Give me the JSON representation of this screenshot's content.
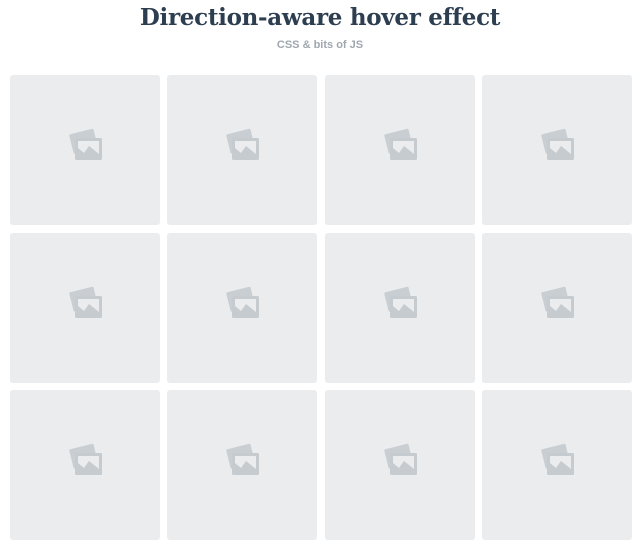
{
  "header": {
    "title": "Direction-aware hover effect",
    "subtitle": "CSS & bits of JS"
  },
  "grid": {
    "tiles": [
      {
        "icon": "image-placeholder-icon"
      },
      {
        "icon": "image-placeholder-icon"
      },
      {
        "icon": "image-placeholder-icon"
      },
      {
        "icon": "image-placeholder-icon"
      },
      {
        "icon": "image-placeholder-icon"
      },
      {
        "icon": "image-placeholder-icon"
      },
      {
        "icon": "image-placeholder-icon"
      },
      {
        "icon": "image-placeholder-icon"
      },
      {
        "icon": "image-placeholder-icon"
      },
      {
        "icon": "image-placeholder-icon"
      },
      {
        "icon": "image-placeholder-icon"
      },
      {
        "icon": "image-placeholder-icon"
      }
    ]
  },
  "colors": {
    "title": "#2c3e50",
    "subtitle": "#a0a7af",
    "tile_background": "#eaecee",
    "icon": "#c6cbd0"
  }
}
